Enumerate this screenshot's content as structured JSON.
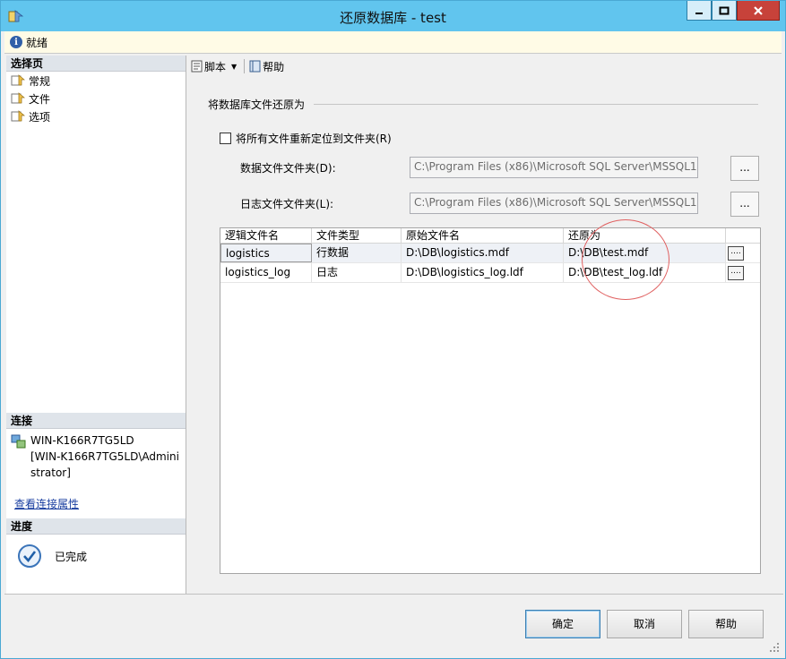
{
  "window": {
    "title": "还原数据库 - test"
  },
  "status": {
    "text": "就绪"
  },
  "left": {
    "select_page_header": "选择页",
    "nav_items": [
      "常规",
      "文件",
      "选项"
    ],
    "connection_header": "连接",
    "server": "WIN-K166R7TG5LD",
    "user_line1": "[WIN-K166R7TG5LD\\Admini",
    "user_line2": "strator]",
    "view_props_link": "查看连接属性",
    "progress_header": "进度",
    "progress_text": "已完成"
  },
  "toolbar": {
    "script_label": "脚本",
    "help_label": "帮助"
  },
  "main": {
    "group_title": "将数据库文件还原为",
    "relocate_label": "将所有文件重新定位到文件夹(R)",
    "data_folder_label": "数据文件文件夹(D):",
    "data_folder_value": "C:\\Program Files (x86)\\Microsoft SQL Server\\MSSQL1",
    "log_folder_label": "日志文件文件夹(L):",
    "log_folder_value": "C:\\Program Files (x86)\\Microsoft SQL Server\\MSSQL1",
    "browse_label": "..."
  },
  "grid": {
    "columns": [
      "逻辑文件名",
      "文件类型",
      "原始文件名",
      "还原为"
    ],
    "rows": [
      {
        "logical": "logistics",
        "type": "行数据",
        "original": "D:\\DB\\logistics.mdf",
        "restore_as": "D:\\DB\\test.mdf",
        "btn": "...."
      },
      {
        "logical": "logistics_log",
        "type": "日志",
        "original": "D:\\DB\\logistics_log.ldf",
        "restore_as": "D:\\DB\\test_log.ldf",
        "btn": "...."
      }
    ]
  },
  "buttons": {
    "ok": "确定",
    "cancel": "取消",
    "help": "帮助"
  },
  "colors": {
    "titlebar": "#61c5ee",
    "status_bg": "#fffbe6",
    "link": "#1a3fa0",
    "annotation": "#e06060"
  }
}
